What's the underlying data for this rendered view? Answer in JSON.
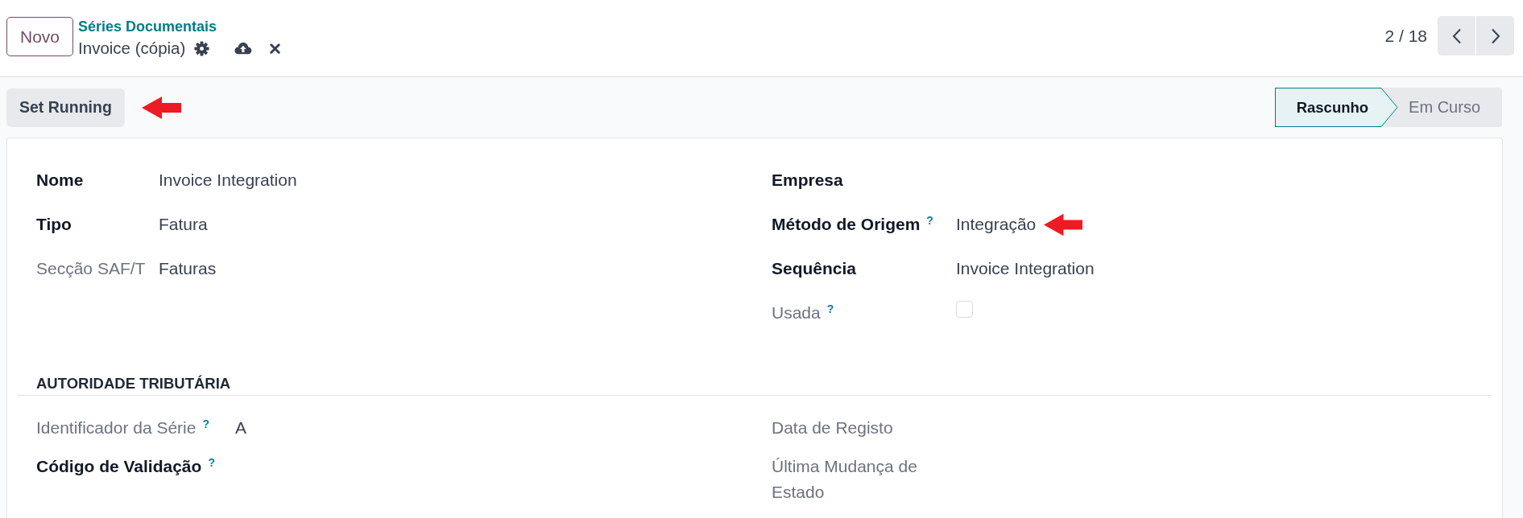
{
  "header": {
    "new_button": "Novo",
    "breadcrumb": "Séries Documentais",
    "record_title": "Invoice (cópia)",
    "pager": "2 / 18"
  },
  "control_bar": {
    "actions": [
      {
        "label": "Set Running",
        "marked": true
      }
    ],
    "stages": [
      {
        "label": "Rascunho",
        "selected": true
      },
      {
        "label": "Em Curso",
        "selected": false
      }
    ]
  },
  "form": {
    "sections": [
      {
        "groups": [
          {
            "fields": [
              {
                "kind": "text",
                "label": "Nome",
                "value": "Invoice Integration",
                "readonly": false,
                "marked": false
              },
              {
                "kind": "text",
                "label": "Tipo",
                "value": "Fatura",
                "readonly": false,
                "marked": false
              },
              {
                "kind": "text",
                "label": "Secção SAF/T",
                "value": "Faturas",
                "readonly": true,
                "marked": false
              }
            ]
          },
          {
            "fields": [
              {
                "kind": "text",
                "label": "Empresa",
                "readonly": false,
                "marked": false
              },
              {
                "kind": "text",
                "label": "Método de Origem",
                "help": "?",
                "value": "Integração",
                "readonly": false,
                "marked": true
              },
              {
                "kind": "text",
                "label": "Sequência",
                "value": "Invoice Integration",
                "readonly": false,
                "marked": false
              },
              {
                "kind": "checkbox",
                "label": "Usada",
                "help": "?",
                "checked": false,
                "readonly": true,
                "marked": false
              }
            ]
          }
        ]
      },
      {
        "title": "AUTORIDADE TRIBUTÁRIA",
        "groups": [
          {
            "fields": [
              {
                "kind": "text",
                "label": "Identificador da Série",
                "help": "?",
                "value": "A",
                "readonly": true,
                "marked": false
              },
              {
                "kind": "text",
                "label": "Código de Validação",
                "help": "?",
                "readonly": false,
                "marked": false
              }
            ]
          },
          {
            "fields": [
              {
                "kind": "text",
                "label": "Data de Registo",
                "readonly": true,
                "marked": false
              },
              {
                "kind": "text",
                "label": "Última Mudança de Estado",
                "readonly": true,
                "marked": false
              }
            ]
          }
        ]
      }
    ]
  }
}
